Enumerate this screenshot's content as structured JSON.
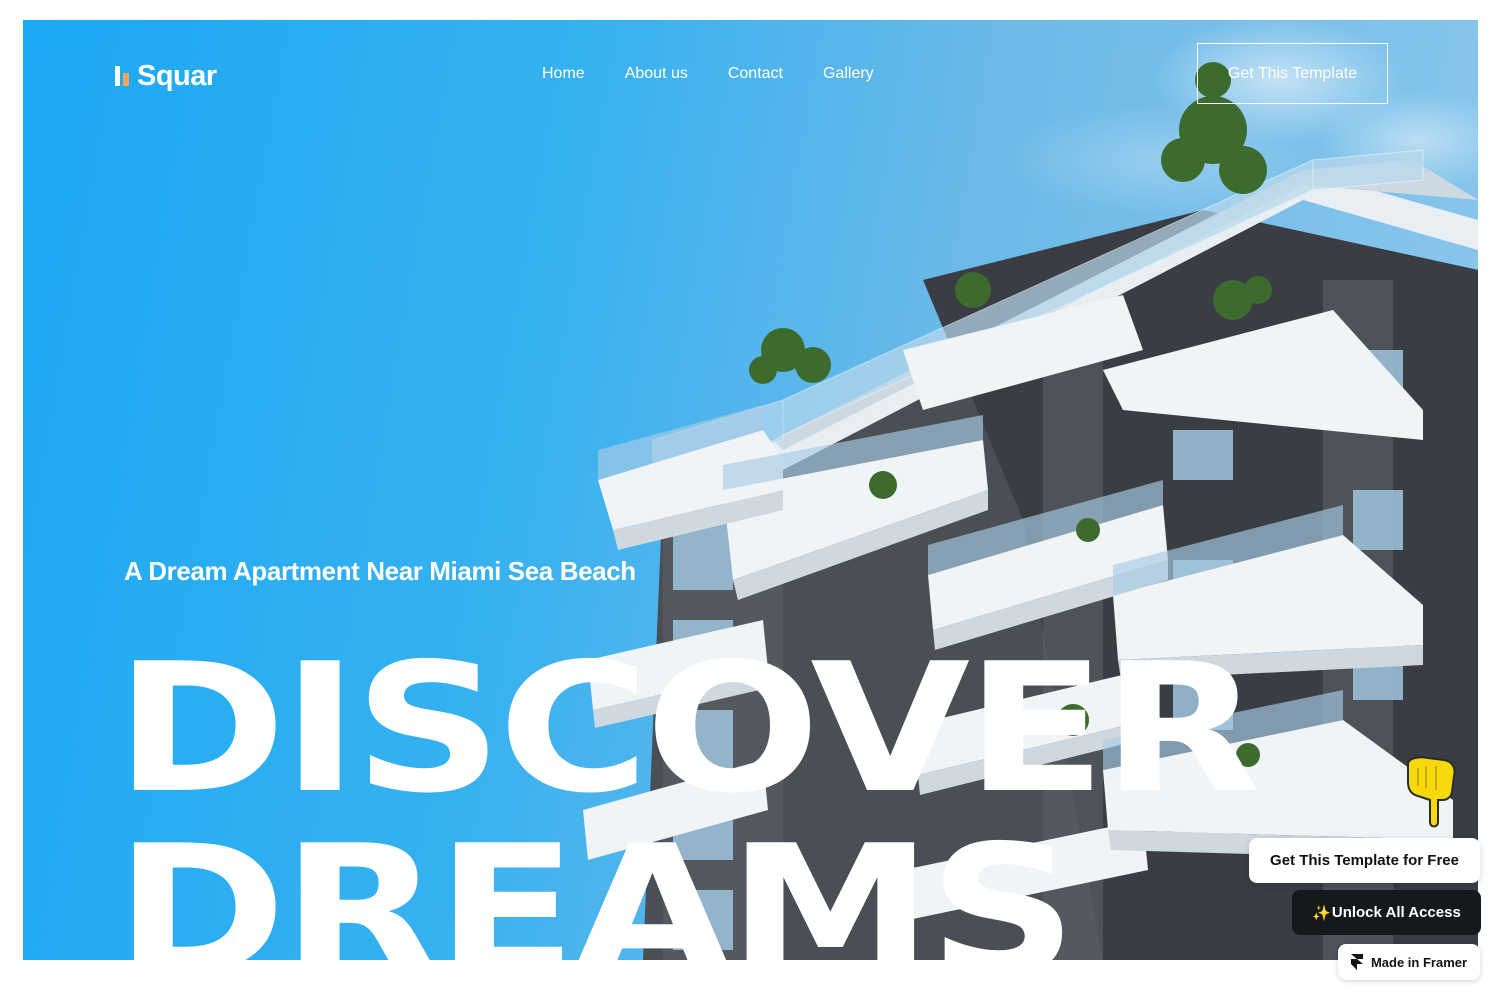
{
  "brand": {
    "name": "Squar",
    "logo_icon": "bar-chart-logo-icon"
  },
  "nav": {
    "items": [
      {
        "label": "Home"
      },
      {
        "label": "About us"
      },
      {
        "label": "Contact"
      },
      {
        "label": "Gallery"
      }
    ]
  },
  "header": {
    "cta_label": "Get This Template"
  },
  "hero": {
    "tagline": "A Dream Apartment Near Miami Sea Beach",
    "headline_line1": "DISCOVER",
    "headline_line2": "DREAMS",
    "background_image": "modern apartment building with balconies against blue sky"
  },
  "promo": {
    "pointer_icon": "pointing-hand-icon",
    "free_label": "Get This Template for Free",
    "unlock_label": "Unlock All Access",
    "unlock_icon": "sparkles-icon",
    "badge_label": "Made in Framer",
    "badge_icon": "framer-logo-icon"
  },
  "colors": {
    "sky_left": "#1ba8f4",
    "sky_right": "#8ec8ec",
    "accent_orange": "#f2a65a",
    "dark_button": "#15181d",
    "hand_yellow": "#f5d90a"
  }
}
